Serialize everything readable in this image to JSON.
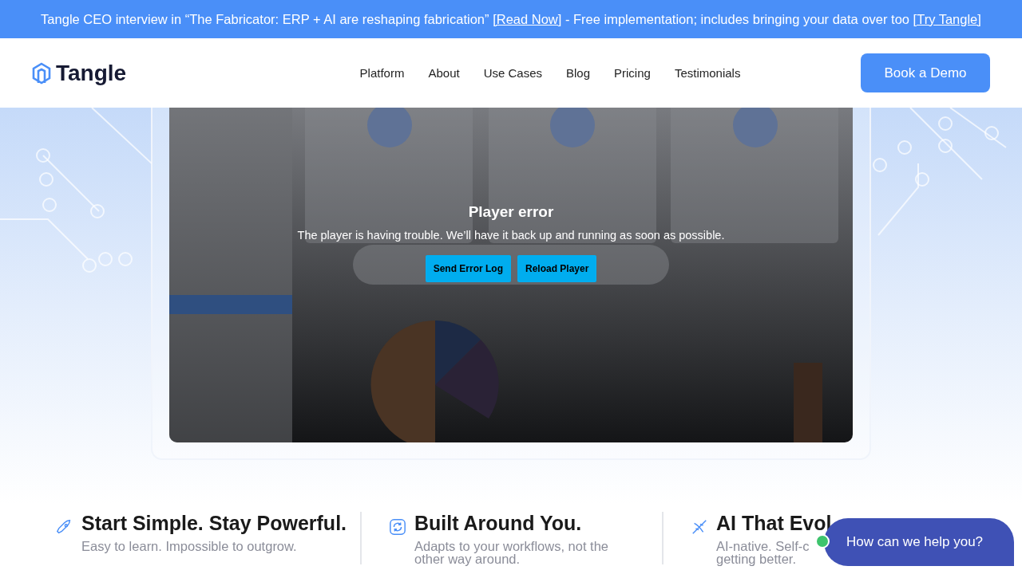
{
  "announcement": {
    "text_before": "Tangle CEO interview in “The Fabricator: ERP + AI are reshaping fabrication”",
    "link_1": "[Read Now]",
    "text_middle": "- Free implementation; includes bringing your data over too",
    "link_2": "[Try Tangle]"
  },
  "nav": {
    "logo": "Tangle",
    "links": [
      "Platform",
      "About",
      "Use Cases",
      "Blog",
      "Pricing",
      "Testimonials"
    ],
    "cta": "Book a Demo"
  },
  "video": {
    "kind": "picture",
    "error": {
      "title": "Player error",
      "message": "The player is having trouble. We’ll have it back up and running as soon as possible.",
      "buttons": [
        "Send Error Log",
        "Reload Player"
      ]
    }
  },
  "features": [
    {
      "title": "Start Simple. Stay Powerful.",
      "lines": [
        "Easy to learn. Impossible to outgrow."
      ]
    },
    {
      "title": "Built Around You.",
      "lines": [
        "Adapts to your workflows, not the",
        "other way around."
      ]
    },
    {
      "title": "AI That Evol",
      "lines": [
        "AI-native. Self-c",
        "getting better."
      ]
    }
  ],
  "chat": {
    "label": "How can we help you?",
    "online": true
  }
}
